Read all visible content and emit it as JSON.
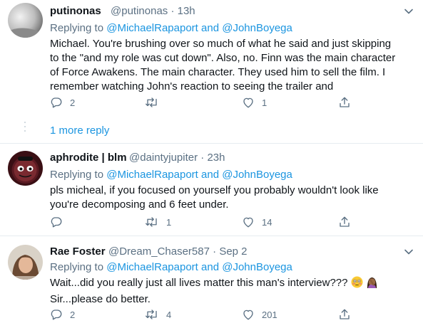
{
  "tweets": [
    {
      "display_name": "putinonas",
      "handle": "@putinonas",
      "separator": "·",
      "time": "13h",
      "replying_prefix": "Replying to",
      "mention_1": "@MichaelRapaport",
      "and_word": "and",
      "mention_2": "@JohnBoyega",
      "lines": [
        "Michael. You're brushing over so much of what he said and just skipping",
        "to the \"and my role was cut down\". Also, no. Finn was the main character",
        "of Force Awakens. The main character. They used him to sell the film. I",
        "remember watching John's reaction to seeing the trailer and"
      ],
      "reply_count": "2",
      "retweet_count": "",
      "like_count": "1"
    },
    {
      "display_name": "aphrodite | blm",
      "handle": "@daintyjupiter",
      "separator": "·",
      "time": "23h",
      "replying_prefix": "Replying to",
      "mention_1": "@MichaelRapaport",
      "and_word": "and",
      "mention_2": "@JohnBoyega",
      "lines": [
        "pls micheal, if you focused on yourself you probably wouldn't look like",
        "you're decomposing and 6 feet under."
      ],
      "reply_count": "",
      "retweet_count": "1",
      "like_count": "14"
    },
    {
      "display_name": "Rae Foster",
      "handle": "@Dream_Chaser587",
      "separator": "·",
      "time": "Sep 2",
      "replying_prefix": "Replying to",
      "mention_1": "@MichaelRapaport",
      "and_word": "and",
      "mention_2": "@JohnBoyega",
      "lines": [
        "Wait...did you really just all lives matter this man's interview???",
        "Sir...please do better."
      ],
      "reply_count": "2",
      "retweet_count": "4",
      "like_count": "201"
    }
  ],
  "thread": {
    "more_replies": "1 more reply"
  },
  "icons": {
    "reply": "reply-icon",
    "retweet": "retweet-icon",
    "like": "heart-icon",
    "share": "share-icon",
    "caret": "chevron-down-icon",
    "emoji_1": "flushed-face-emoji",
    "emoji_2": "woman-facepalming-emoji"
  },
  "colors": {
    "link": "#1b95e0",
    "secondary_text": "#5b7083",
    "primary_text": "#0f1419",
    "divider": "#e6ecf0"
  }
}
